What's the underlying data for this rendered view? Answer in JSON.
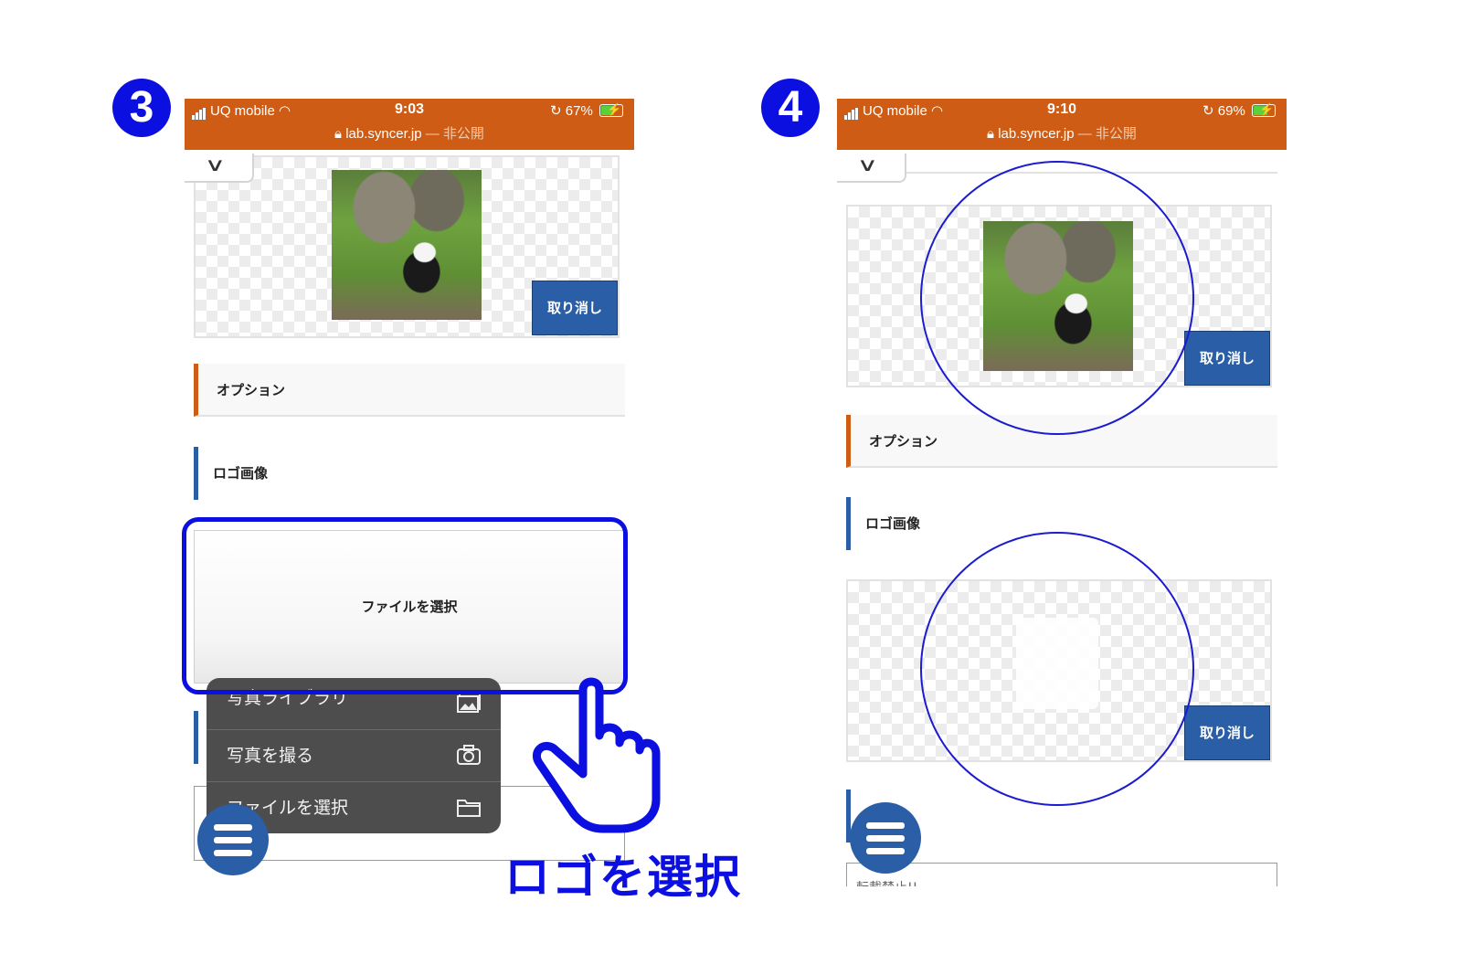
{
  "left": {
    "step": "3",
    "status": {
      "carrier": "UQ mobile",
      "time": "9:03",
      "battery": "67%",
      "url": "lab.syncer.jp",
      "url_suffix": "— 非公開"
    },
    "cancel_label": "取り消し",
    "options_label": "オプション",
    "logo_label": "ロゴ画像",
    "file_button_label": "ファイルを選択",
    "menu": [
      {
        "label": "写真ライブラリ",
        "icon": "photo-library-icon"
      },
      {
        "label": "写真を撮る",
        "icon": "camera-icon"
      },
      {
        "label": "ファイルを選択",
        "icon": "folder-icon"
      }
    ],
    "caption": "ロゴを選択"
  },
  "right": {
    "step": "4",
    "status": {
      "carrier": "UQ mobile",
      "time": "9:10",
      "battery": "69%",
      "url": "lab.syncer.jp",
      "url_suffix": "— 非公開"
    },
    "cancel_label": "取り消し",
    "options_label": "オプション",
    "logo_label": "ロゴ画像",
    "partial_text": "転載禁止!!"
  },
  "colors": {
    "accent_orange": "#cf5c14",
    "accent_blue": "#2a5ea6",
    "highlight": "#0b10e0"
  }
}
